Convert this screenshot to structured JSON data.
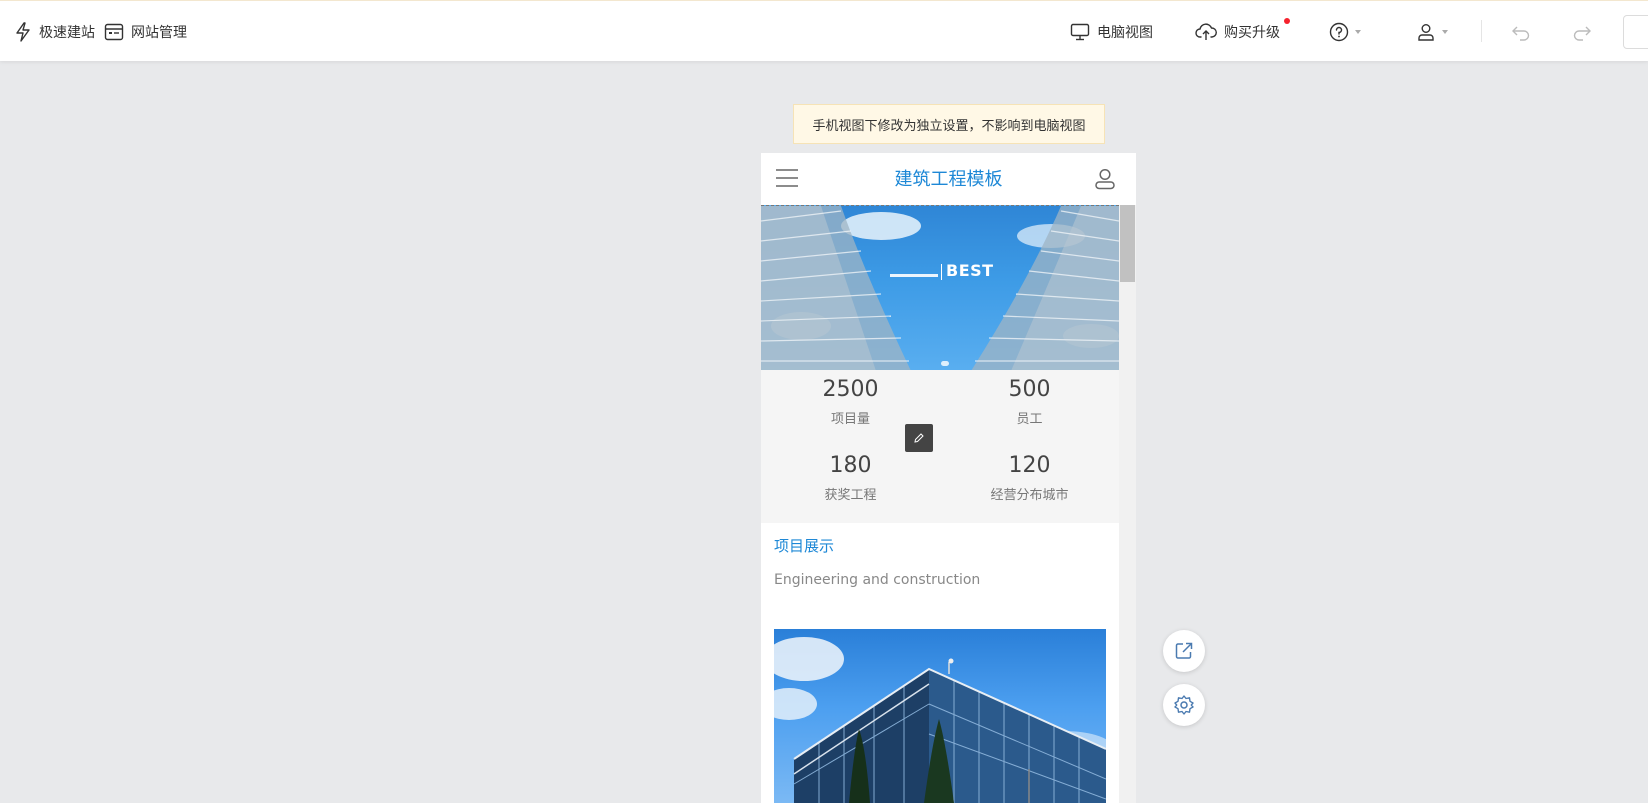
{
  "toolbar": {
    "quick_build": "极速建站",
    "site_manage": "网站管理",
    "pc_view": "电脑视图",
    "upgrade": "购买升级"
  },
  "notice": "手机视图下修改为独立设置，不影响到电脑视图",
  "phone": {
    "title": "建筑工程模板",
    "banner_text": "BEST",
    "stats": [
      {
        "value": "2500",
        "label": "项目量"
      },
      {
        "value": "500",
        "label": "员工"
      },
      {
        "value": "180",
        "label": "获奖工程"
      },
      {
        "value": "120",
        "label": "经营分布城市"
      }
    ],
    "section_title": "项目展示",
    "section_subtitle": "Engineering and construction"
  },
  "colors": {
    "accent": "#1e88d6",
    "notice_bg": "#fff8e6",
    "page_bg": "#e8e9eb"
  }
}
